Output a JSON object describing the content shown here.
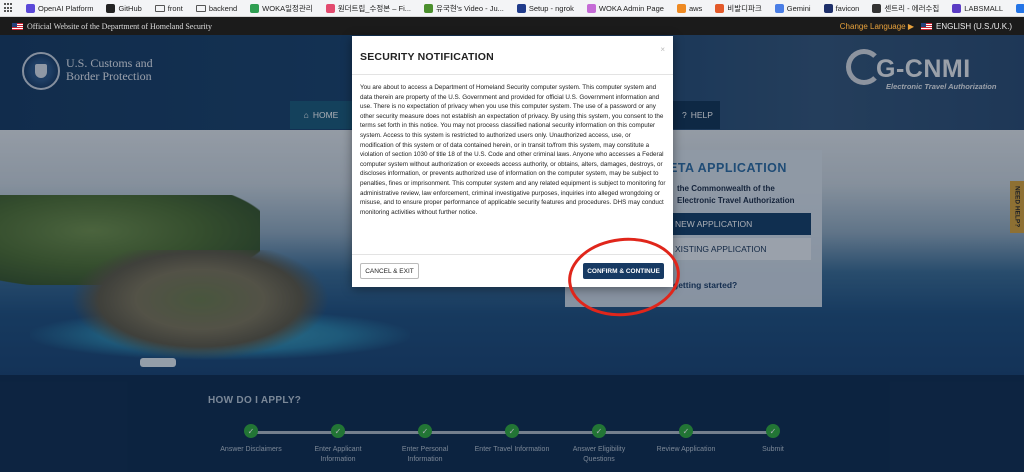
{
  "bookmarks": [
    {
      "label": "OpenAI Platform",
      "color": "#5a48d8"
    },
    {
      "label": "GitHub",
      "color": "#222222"
    },
    {
      "label": "front",
      "folder": true
    },
    {
      "label": "backend",
      "folder": true
    },
    {
      "label": "WOKA일정관리",
      "color": "#2f9e52"
    },
    {
      "label": "원더트립_수정본 – Fi...",
      "color": "#e24a6e"
    },
    {
      "label": "유국현's Video - Ju...",
      "color": "#4b8f2d"
    },
    {
      "label": "Setup - ngrok",
      "color": "#1f3a8a"
    },
    {
      "label": "WOKA Admin Page",
      "color": "#c56bd6"
    },
    {
      "label": "aws",
      "color": "#ee8a22"
    },
    {
      "label": "비발디파크",
      "color": "#e35a2a"
    },
    {
      "label": "Gemini",
      "color": "#4a7ee6"
    },
    {
      "label": "favicon",
      "color": "#1e2f6a"
    },
    {
      "label": "센트리 - 에러수집",
      "color": "#333333"
    },
    {
      "label": "LABSMALL",
      "color": "#5b3cc4"
    },
    {
      "label": "jira",
      "color": "#2474e6"
    }
  ],
  "govbar": {
    "official": "Official Website of the Department of Homeland Security",
    "change_language": "Change Language ▶",
    "language": "ENGLISH (U.S./U.K.)"
  },
  "header": {
    "agency_line1": "U.S. Customs and",
    "agency_line2": "Border Protection",
    "logo_text": "G-CNMI",
    "logo_sub": "Electronic Travel Authorization"
  },
  "nav": {
    "home": "HOME",
    "help": "HELP"
  },
  "panel": {
    "title": "ETA APPLICATION",
    "desc_line1": "the Commonwealth of the",
    "desc_line2": "Electronic Travel Authorization",
    "new_application": "NEW APPLICATION",
    "existing_application": "XISTING APPLICATION",
    "link": "getting started?"
  },
  "need_help": "NEED HELP?",
  "how": {
    "title": "HOW DO I APPLY?",
    "steps": [
      {
        "line1": "Answer Disclaimers",
        "line2": ""
      },
      {
        "line1": "Enter Applicant",
        "line2": "Information"
      },
      {
        "line1": "Enter Personal",
        "line2": "Information"
      },
      {
        "line1": "Enter Travel Information",
        "line2": ""
      },
      {
        "line1": "Answer Eligibility",
        "line2": "Questions"
      },
      {
        "line1": "Review Application",
        "line2": ""
      },
      {
        "line1": "Submit",
        "line2": ""
      }
    ]
  },
  "modal": {
    "title": "SECURITY NOTIFICATION",
    "close": "×",
    "body": "You are about to access a Department of Homeland Security computer system. This computer system and data therein are property of the U.S. Government and provided for official U.S. Government information and use. There is no expectation of privacy when you use this computer system. The use of a password or any other security measure does not establish an expectation of privacy. By using this system, you consent to the terms set forth in this notice. You may not process classified national security information on this computer system. Access to this system is restricted to authorized users only. Unauthorized access, use, or modification of this system or of data contained herein, or in transit to/from this system, may constitute a violation of section 1030 of title 18 of the U.S. Code and other criminal laws. Anyone who accesses a Federal computer system without authorization or exceeds access authority, or obtains, alters, damages, destroys, or discloses information, or prevents authorized use of information on the computer system, may be subject to penalties, fines or imprisonment. This computer system and any related equipment is subject to monitoring for administrative review, law enforcement, criminal investigative purposes, inquiries into alleged wrongdoing or misuse, and to ensure proper performance of applicable security features and procedures. DHS may conduct monitoring activities without further notice.",
    "cancel": "CANCEL & EXIT",
    "confirm": "CONFIRM & CONTINUE"
  },
  "colors": {
    "annotation": "#e0261b",
    "step_done": "#31a93c",
    "confirm_button": "#173a63"
  }
}
